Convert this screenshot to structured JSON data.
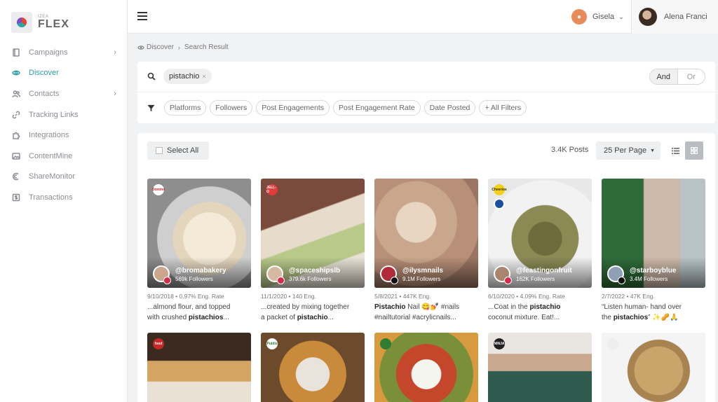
{
  "brand": {
    "small": "IZEA",
    "name": "FLEX"
  },
  "sidebar": {
    "items": [
      {
        "label": "Campaigns",
        "chevron": "›"
      },
      {
        "label": "Discover"
      },
      {
        "label": "Contacts",
        "chevron": "›"
      },
      {
        "label": "Tracking Links"
      },
      {
        "label": "Integrations"
      },
      {
        "label": "ContentMine"
      },
      {
        "label": "ShareMonitor"
      },
      {
        "label": "Transactions"
      }
    ]
  },
  "topbar": {
    "account": "Gisela",
    "account_caret": "⌄",
    "user": "Alena Franci"
  },
  "breadcrumb": {
    "root": "Discover",
    "sep": "›",
    "current": "Search Result"
  },
  "search": {
    "tag": "pistachio",
    "tag_remove": "×",
    "and": "And",
    "or": "Or"
  },
  "filters": [
    "Platforms",
    "Followers",
    "Post Engagements",
    "Post Engagement Rate",
    "Date Posted",
    "+ All Filters"
  ],
  "results": {
    "select_all": "Select All",
    "count": "3.4K Posts",
    "per_page": "25 Per Page",
    "per_page_caret": "▼"
  },
  "posts": [
    {
      "brand": "Domino",
      "handle": "@bromabakery",
      "followers": "569k Followers",
      "meta": "9/10/2018 • 0.97% Eng. Rate",
      "cap1": "...almond flour, and topped",
      "cap2_pre": "with crushed ",
      "cap2_bold": "pistachios",
      "cap2_post": "..."
    },
    {
      "brand": "JELL-O",
      "handle": "@spaceshipslb",
      "followers": "379.6k Followers",
      "meta": "11/1/2020 • 140 Eng.",
      "cap1": "...created by mixing together",
      "cap2_pre": "a packet of ",
      "cap2_bold": "pistachio",
      "cap2_post": "..."
    },
    {
      "brand": "",
      "handle": "@ilysmnails",
      "followers": "9.1M Followers",
      "meta": "5/8/2021 • 447K Eng.",
      "cap1_bold": "Pistachio",
      "cap1": " Nail 😋💅 #nails",
      "cap2_pre": "#nailtutorial #acrylicnails...",
      "cap2_bold": "",
      "cap2_post": ""
    },
    {
      "brand": "Cheerios",
      "handle": "@feastingonfruit",
      "followers": "162K Followers",
      "meta": "6/10/2020 • 4.09% Eng. Rate",
      "cap1": "...Coat in the ",
      "cap1_bold_after": "pistachio",
      "cap2_pre": "coconut mixture. Eat!...",
      "cap2_bold": "",
      "cap2_post": ""
    },
    {
      "brand": "",
      "handle": "@starboyblue",
      "followers": "3.4M Followers",
      "meta": "2/7/2022 • 47K Eng.",
      "cap1": "“Listen human- hand over",
      "cap2_pre": "the ",
      "cap2_bold": "pistachios",
      "cap2_post": "” ✨🥜🙏"
    }
  ],
  "row2_brands": [
    "food",
    "Publix",
    "",
    "NINJA",
    ""
  ]
}
